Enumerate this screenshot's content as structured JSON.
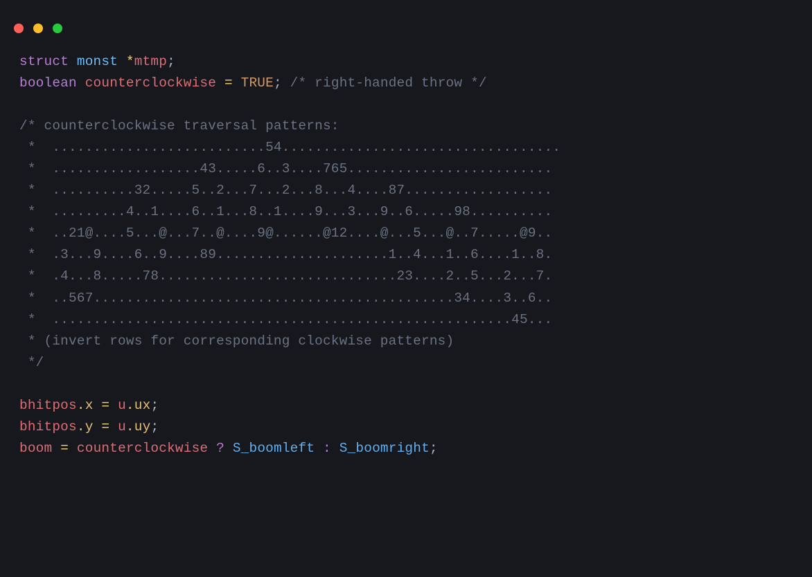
{
  "line1": {
    "kw_struct": "struct",
    "type_monst": "monst",
    "star": "*",
    "id_mtmp": "mtmp",
    "semi": ";"
  },
  "line2": {
    "kw_boolean": "boolean",
    "id_ccw": "counterclockwise",
    "eq": "=",
    "const_true": "TRUE",
    "semi": ";",
    "comment_rh": "/* right-handed throw */"
  },
  "comment_block": {
    "l0": "/* counterclockwise traversal patterns:",
    "l1": " *  ..........................54..................................",
    "l2": " *  ..................43.....6..3....765.........................",
    "l3": " *  ..........32.....5..2...7...2...8...4....87..................",
    "l4": " *  .........4..1....6..1...8..1....9...3...9..6.....98..........",
    "l5": " *  ..21@....5...@...7..@....9@......@12....@...5...@..7.....@9..",
    "l6": " *  .3...9....6..9....89.....................1..4...1..6....1..8.",
    "l7": " *  .4...8.....78.............................23....2..5...2...7.",
    "l8": " *  ..567............................................34....3..6..",
    "l9": " *  ........................................................45...",
    "l10": " * (invert rows for corresponding clockwise patterns)",
    "l11": " */"
  },
  "line3": {
    "id_bhitpos": "bhitpos",
    "dot_x": ".x",
    "eq": "=",
    "id_u": "u",
    "dot_ux": ".ux",
    "semi": ";"
  },
  "line4": {
    "id_bhitpos": "bhitpos",
    "dot_y": ".y",
    "eq": "=",
    "id_u": "u",
    "dot_uy": ".uy",
    "semi": ";"
  },
  "line5": {
    "id_boom": "boom",
    "eq": "=",
    "id_ccw": "counterclockwise",
    "q": "?",
    "fn_left": "S_boomleft",
    "colon": ":",
    "fn_right": "S_boomright",
    "semi": ";"
  }
}
